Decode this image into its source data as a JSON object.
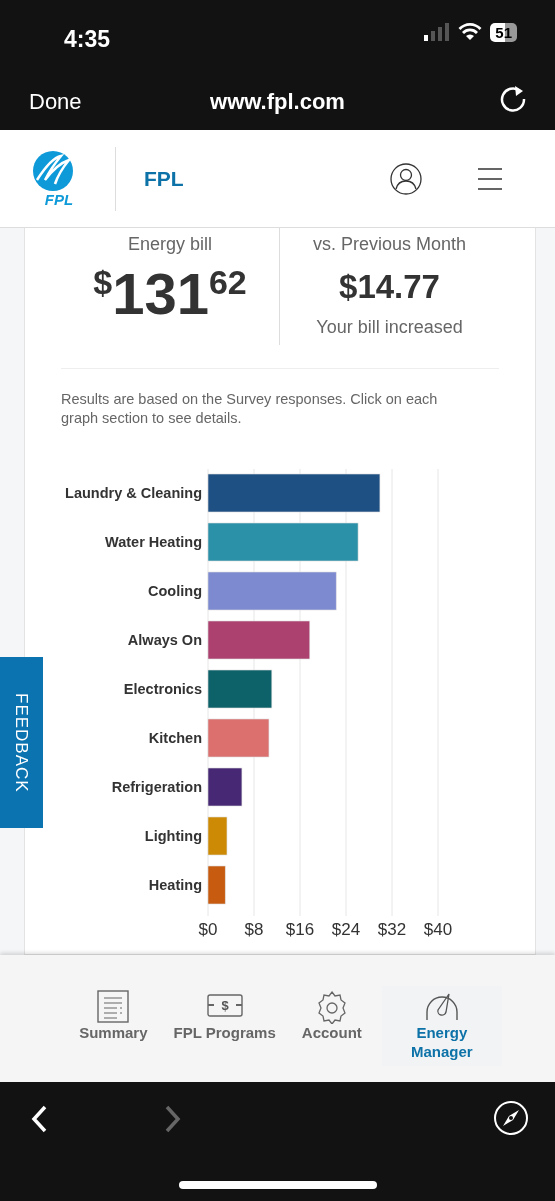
{
  "status_bar": {
    "time": "4:35",
    "battery": "51"
  },
  "browser": {
    "done": "Done",
    "url": "www.fpl.com"
  },
  "header": {
    "logo_text": "FPL",
    "brand": "FPL"
  },
  "bill": {
    "label": "Energy bill",
    "currency": "$",
    "dollars": "131",
    "cents": "62"
  },
  "comparison": {
    "label": "vs. Previous Month",
    "amount": "$14.77",
    "note": "Your bill increased"
  },
  "note": "Results are based on the Survey responses. Click on each graph section to see details.",
  "chart_data": {
    "type": "bar",
    "orientation": "horizontal",
    "stacked": true,
    "grid": true,
    "series": [
      {
        "name": "Laundry & Cleaning",
        "color": "#1e5084",
        "values": [
          29.9,
          null,
          null,
          null,
          null,
          null,
          null,
          null,
          null
        ]
      },
      {
        "name": "Water Heating",
        "color": "#2a91a8",
        "values": [
          null,
          26.1,
          null,
          null,
          null,
          null,
          null,
          null,
          null
        ]
      },
      {
        "name": "Cooling",
        "color": "#7d8ad0",
        "values": [
          null,
          null,
          22.3,
          null,
          null,
          null,
          null,
          null,
          null
        ]
      },
      {
        "name": "Always On",
        "color": "#ac4170",
        "values": [
          null,
          null,
          null,
          17.7,
          null,
          null,
          null,
          null,
          null
        ]
      },
      {
        "name": "Electronics",
        "color": "#0c6268",
        "values": [
          null,
          null,
          null,
          null,
          11.1,
          null,
          null,
          null,
          null
        ]
      },
      {
        "name": "Kitchen",
        "color": "#db706f",
        "values": [
          null,
          null,
          null,
          null,
          null,
          10.6,
          null,
          null,
          null
        ]
      },
      {
        "name": "Refrigeration",
        "color": "#472874",
        "values": [
          null,
          null,
          null,
          null,
          null,
          null,
          5.9,
          null,
          null
        ]
      },
      {
        "name": "Lighting",
        "color": "#cc8a05",
        "values": [
          null,
          null,
          null,
          null,
          null,
          null,
          null,
          3.3,
          null
        ]
      },
      {
        "name": "Heating",
        "color": "#c75b10",
        "values": [
          null,
          null,
          null,
          null,
          null,
          null,
          null,
          null,
          3.0
        ]
      }
    ],
    "xlim": [
      0,
      40
    ],
    "xticks": [
      {
        "value": 0,
        "label": "$0"
      },
      {
        "value": 8,
        "label": "$8"
      },
      {
        "value": 16,
        "label": "$16"
      },
      {
        "value": 24,
        "label": "$24"
      },
      {
        "value": 32,
        "label": "$32"
      },
      {
        "value": 40,
        "label": "$40"
      }
    ]
  },
  "feedback": "FEEDBACK",
  "tabs": [
    {
      "kind": "summary",
      "label": "Summary",
      "selected": false
    },
    {
      "kind": "programs",
      "label": "FPL Programs",
      "icon_text": "$",
      "selected": false
    },
    {
      "kind": "account",
      "label": "Account",
      "selected": false
    },
    {
      "kind": "energy",
      "label": "Energy Manager",
      "selected": true
    }
  ],
  "nav": {
    "back_disabled": false,
    "forward_disabled": true
  }
}
